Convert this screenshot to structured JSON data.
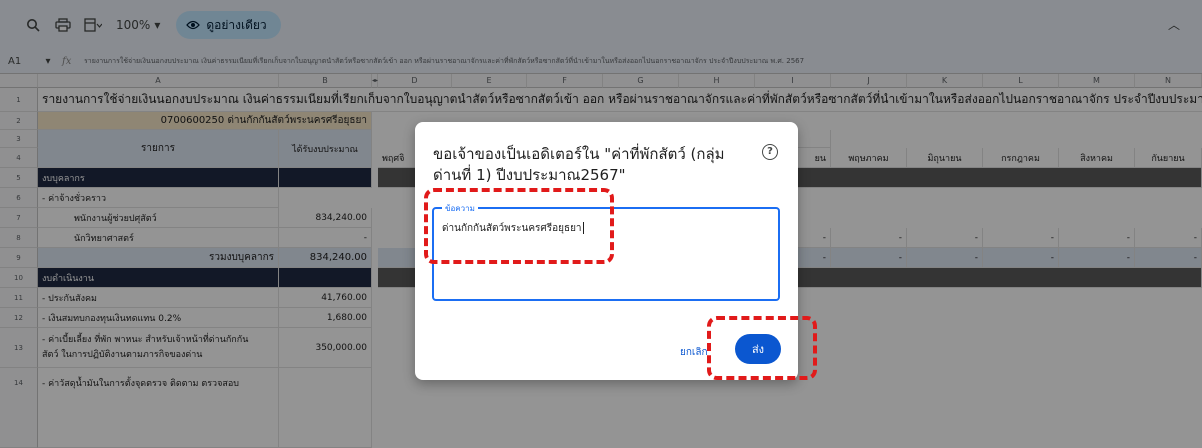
{
  "toolbar": {
    "zoom": "100%",
    "view_only_label": "ดูอย่างเดียว"
  },
  "formula_bar": {
    "cell_ref": "A1",
    "fx": "fx",
    "content": "รายงานการใช้จ่ายเงินนอกงบประมาณ เงินค่าธรรมเนียมที่เรียกเก็บจากใบอนุญาตนำสัตว์หรือซากสัตว์เข้า ออก หรือผ่านราชอาณาจักรและค่าที่พักสัตว์หรือซากสัตว์ที่นำเข้ามาในหรือส่งออกไปนอกราชอาณาจักร ประจำปีงบประมาณ พ.ศ. 2567"
  },
  "sheet": {
    "columns": [
      "A",
      "B",
      "D",
      "E",
      "F",
      "G",
      "H",
      "I",
      "J",
      "K",
      "L",
      "M",
      "N"
    ],
    "row_numbers": [
      "1",
      "2",
      "3",
      "4",
      "5",
      "6",
      "7",
      "8",
      "9",
      "10",
      "11",
      "12",
      "13",
      "14"
    ],
    "title": "รายงานการใช้จ่ายเงินนอกงบประมาณ เงินค่าธรรมเนียมที่เรียกเก็บจากใบอนุญาตนำสัตว์หรือซากสัตว์เข้า ออก หรือผ่านราชอาณาจักรและค่าที่พักสัตว์หรือซากสัตว์ที่นำเข้ามาในหรือส่งออกไปนอกราชอาณาจักร ประจำปีงบประมาณ พ.ศ. 2567",
    "unit_name": "0700600250 ด่านกักกันสัตว์พระนครศรีอยุธยา",
    "header_item": "รายการ",
    "header_budget": "ได้รับงบประมาณ",
    "header_expense_partial": "าย",
    "months": [
      "พฤศจิ",
      "ยน",
      "พฤษภาคม",
      "มิถุนายน",
      "กรกฎาคม",
      "สิงหาคม",
      "กันยายน"
    ],
    "rows": [
      {
        "label": "งบบุคลากร",
        "value": ""
      },
      {
        "label": "- ค่าจ้างชั่วคราว",
        "value": ""
      },
      {
        "label": "พนักงานผู้ช่วยปศุสัตว์",
        "value": "834,240.00"
      },
      {
        "label": "นักวิทยาศาสตร์",
        "value": "-"
      },
      {
        "label": "รวมงบบุคลากร",
        "value": "834,240.00"
      },
      {
        "label": "งบดำเนินงาน",
        "value": ""
      },
      {
        "label": "- ประกันสังคม",
        "value": "41,760.00"
      },
      {
        "label": "- เงินสมทบกองทุนเงินทดแทน 0.2%",
        "value": "1,680.00"
      },
      {
        "label": "- ค่าเบี้ยเลี้ยง ที่พัก พาหนะ สำหรับเจ้าหน้าที่ด่านกักกัน",
        "label2": "สัตว์ ในการปฏิบัติงานตามภารกิจของด่าน",
        "value": "350,000.00"
      },
      {
        "label": "- ค่าวัสดุน้ำมันในการตั้งจุดตรวจ ติดตาม ตรวจสอบ",
        "value": ""
      }
    ],
    "dash": "-"
  },
  "dialog": {
    "title": "ขอเจ้าของเป็นเอดิเตอร์ใน \"ค่าที่พักสัตว์ (กลุ่ม ด่านที่ 1) ปีงบประมาณ2567\"",
    "help_icon": "?",
    "message_label": "ข้อความ",
    "message_value": "ด่านกักกันสัตว์พระนครศรีอยุธยา",
    "cancel_label": "ยกเลิก",
    "send_label": "ส่ง"
  },
  "colors": {
    "accent": "#0b57d0",
    "highlight": "#e11a1a",
    "section_bg": "#1f2a44"
  }
}
